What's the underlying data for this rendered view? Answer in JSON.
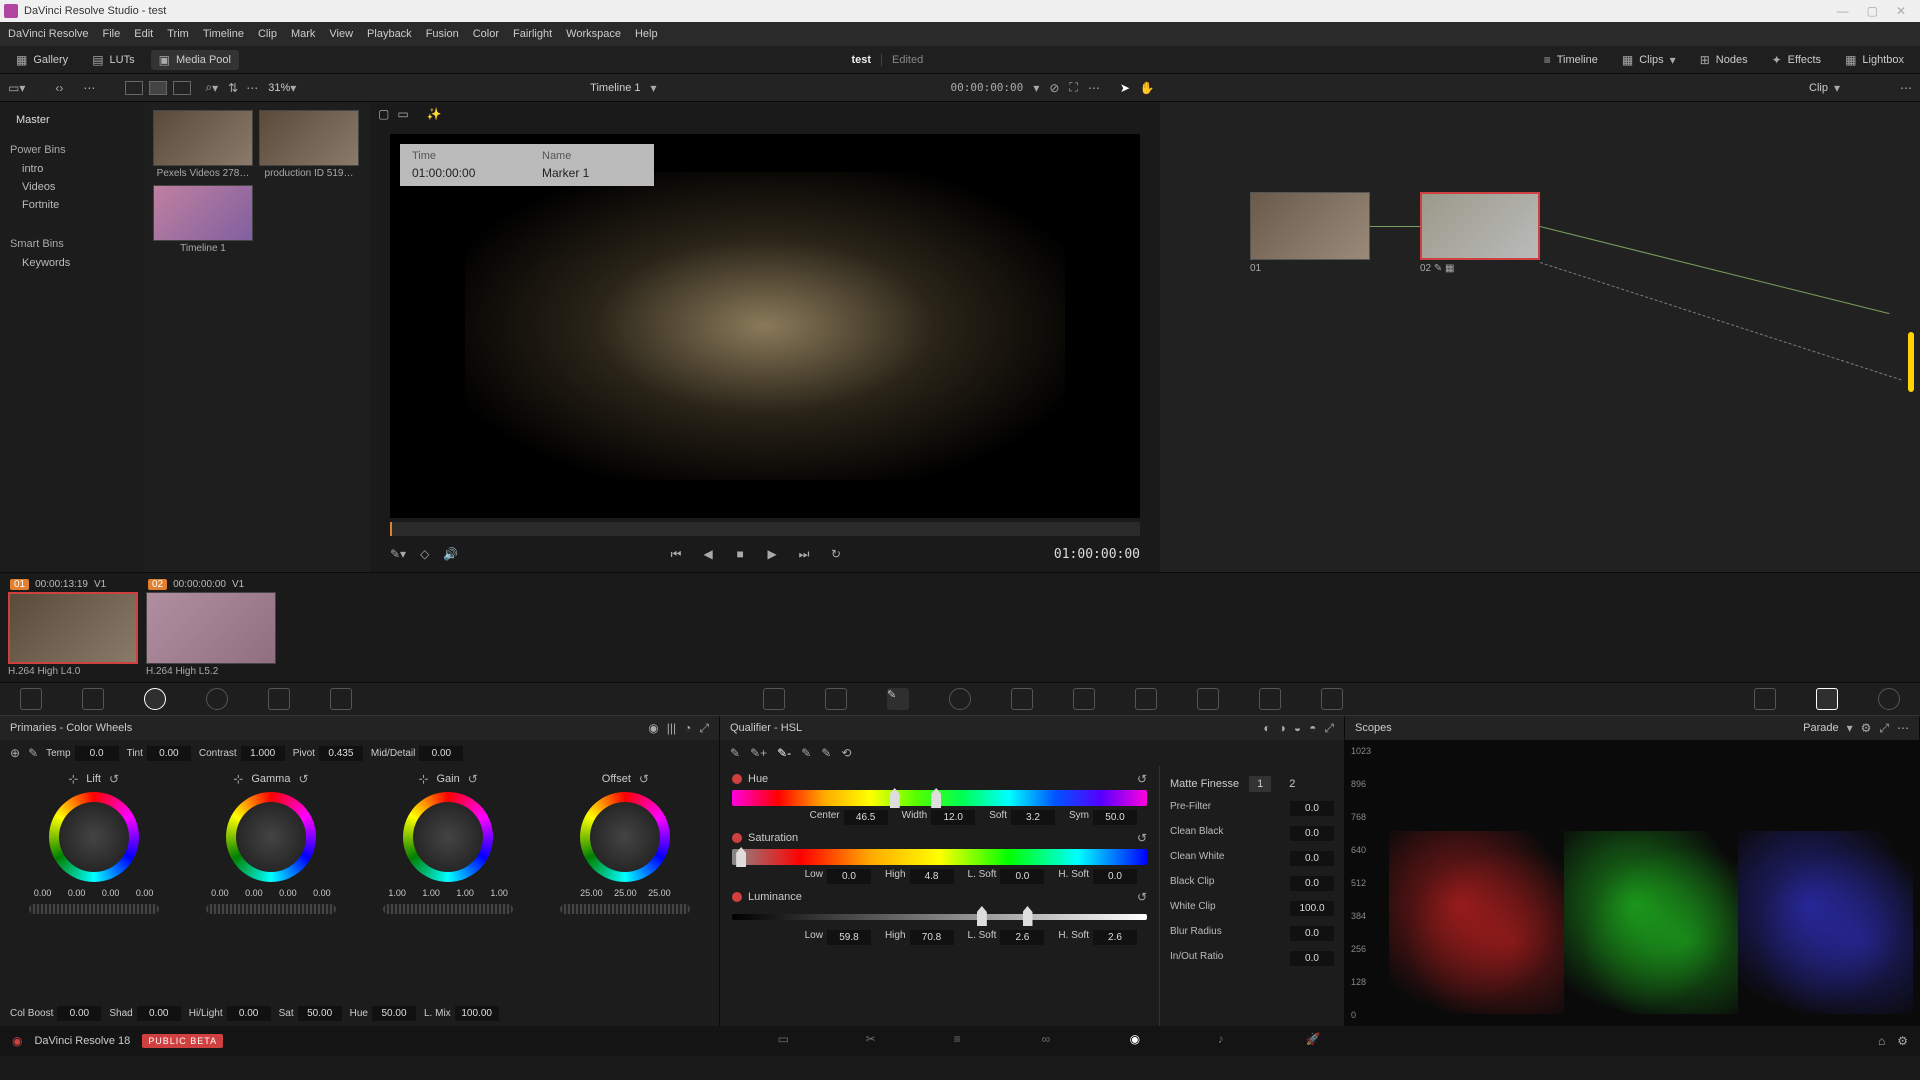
{
  "titlebar": {
    "app": "DaVinci Resolve Studio",
    "project": "test"
  },
  "menu": [
    "DaVinci Resolve",
    "File",
    "Edit",
    "Trim",
    "Timeline",
    "Clip",
    "Mark",
    "View",
    "Playback",
    "Fusion",
    "Color",
    "Fairlight",
    "Workspace",
    "Help"
  ],
  "toolbar": {
    "gallery": "Gallery",
    "luts": "LUTs",
    "mediapool": "Media Pool",
    "project": "test",
    "edited": "Edited",
    "timeline": "Timeline",
    "clips": "Clips",
    "nodes": "Nodes",
    "effects": "Effects",
    "lightbox": "Lightbox"
  },
  "subbar": {
    "zoom": "31%",
    "timeline": "Timeline 1",
    "tc": "00:00:00:00",
    "clip": "Clip"
  },
  "leftpanel": {
    "master": "Master",
    "powerbins": "Power Bins",
    "power_items": [
      "intro",
      "Videos",
      "Fortnite"
    ],
    "smartbins": "Smart Bins",
    "smart_items": [
      "Keywords"
    ]
  },
  "media": [
    {
      "cap": "Pexels Videos 278…"
    },
    {
      "cap": "production ID 519…"
    },
    {
      "cap": "Timeline 1",
      "pink": true
    }
  ],
  "marker": {
    "time_lbl": "Time",
    "time_val": "01:00:00:00",
    "name_lbl": "Name",
    "name_val": "Marker 1"
  },
  "transport_tc": "01:00:00:00",
  "nodes": {
    "n1": "01",
    "n2": "02"
  },
  "clips": [
    {
      "num": "01",
      "tc": "00:00:13:19",
      "trk": "V1",
      "fmt": "H.264 High L4.0"
    },
    {
      "num": "02",
      "tc": "00:00:00:00",
      "trk": "V1",
      "fmt": "H.264 High L5.2"
    }
  ],
  "primaries": {
    "title": "Primaries - Color Wheels",
    "adjust": {
      "temp_l": "Temp",
      "temp": "0.0",
      "tint_l": "Tint",
      "tint": "0.00",
      "contrast_l": "Contrast",
      "contrast": "1.000",
      "pivot_l": "Pivot",
      "pivot": "0.435",
      "md_l": "Mid/Detail",
      "md": "0.00"
    },
    "wheels": [
      {
        "name": "Lift",
        "vals": [
          "0.00",
          "0.00",
          "0.00",
          "0.00"
        ]
      },
      {
        "name": "Gamma",
        "vals": [
          "0.00",
          "0.00",
          "0.00",
          "0.00"
        ]
      },
      {
        "name": "Gain",
        "vals": [
          "1.00",
          "1.00",
          "1.00",
          "1.00"
        ]
      },
      {
        "name": "Offset",
        "vals": [
          "25.00",
          "25.00",
          "25.00"
        ]
      }
    ],
    "bottom": {
      "colboost_l": "Col Boost",
      "colboost": "0.00",
      "shad_l": "Shad",
      "shad": "0.00",
      "hilight_l": "Hi/Light",
      "hilight": "0.00",
      "sat_l": "Sat",
      "sat": "50.00",
      "hue_l": "Hue",
      "hue": "50.00",
      "lmix_l": "L. Mix",
      "lmix": "100.00"
    }
  },
  "qualifier": {
    "title": "Qualifier - HSL",
    "hue": {
      "name": "Hue",
      "center_l": "Center",
      "center": "46.5",
      "width_l": "Width",
      "width": "12.0",
      "soft_l": "Soft",
      "soft": "3.2",
      "sym_l": "Sym",
      "sym": "50.0"
    },
    "sat": {
      "name": "Saturation",
      "low_l": "Low",
      "low": "0.0",
      "high_l": "High",
      "high": "4.8",
      "ls_l": "L. Soft",
      "ls": "0.0",
      "hs_l": "H. Soft",
      "hs": "0.0"
    },
    "lum": {
      "name": "Luminance",
      "low_l": "Low",
      "low": "59.8",
      "high_l": "High",
      "high": "70.8",
      "ls_l": "L. Soft",
      "ls": "2.6",
      "hs_l": "H. Soft",
      "hs": "2.6"
    },
    "matte": {
      "title": "Matte Finesse",
      "tab1": "1",
      "tab2": "2",
      "rows": [
        {
          "l": "Pre-Filter",
          "v": "0.0"
        },
        {
          "l": "Clean Black",
          "v": "0.0"
        },
        {
          "l": "Clean White",
          "v": "0.0"
        },
        {
          "l": "Black Clip",
          "v": "0.0"
        },
        {
          "l": "White Clip",
          "v": "100.0"
        },
        {
          "l": "Blur Radius",
          "v": "0.0"
        },
        {
          "l": "In/Out Ratio",
          "v": "0.0"
        }
      ]
    }
  },
  "scopes": {
    "title": "Scopes",
    "mode": "Parade",
    "ticks": [
      "1023",
      "896",
      "768",
      "640",
      "512",
      "384",
      "256",
      "128",
      "0"
    ]
  },
  "bottom": {
    "version": "DaVinci Resolve 18",
    "beta": "PUBLIC BETA"
  }
}
